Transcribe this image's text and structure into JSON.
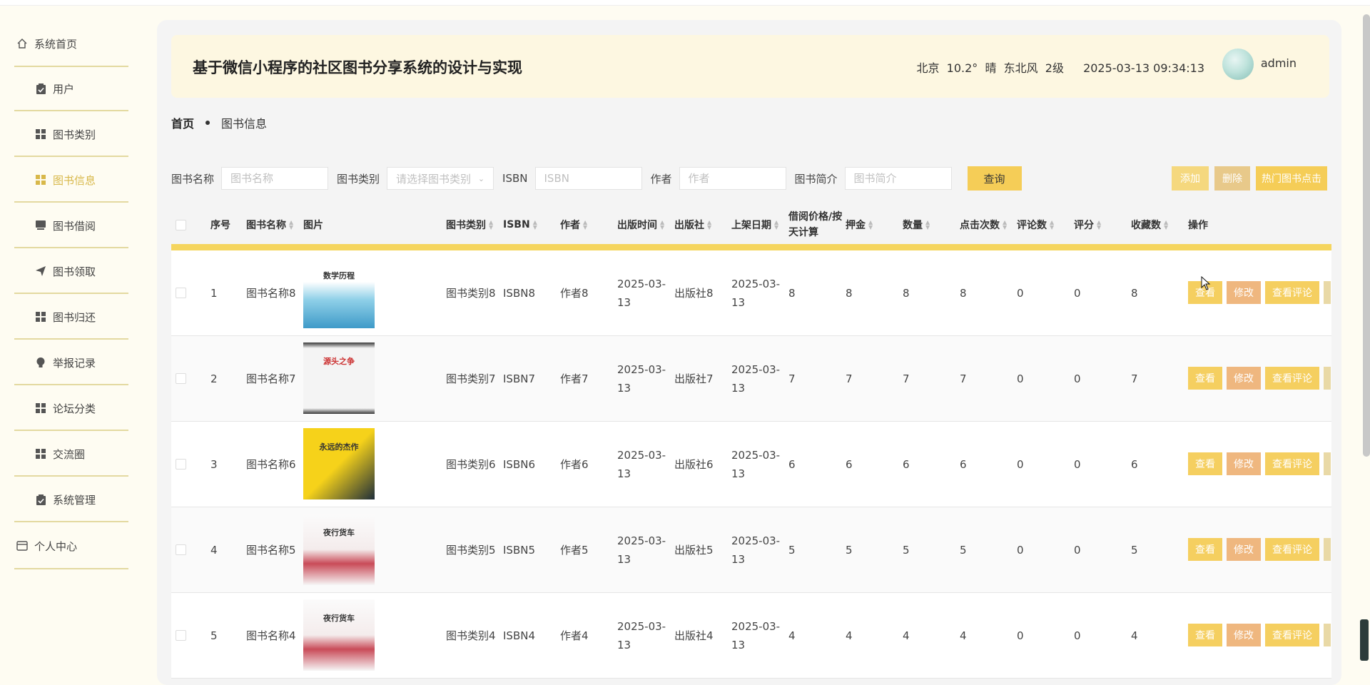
{
  "app_title": "基于微信小程序的社区图书分享系统的设计与实现",
  "header": {
    "weather": "北京  10.2°  晴  东北风  2级",
    "datetime": "2025-03-13 09:34:13",
    "username": "admin"
  },
  "sidebar": {
    "items": [
      {
        "label": "系统首页",
        "icon": "home-icon"
      },
      {
        "label": "用户",
        "icon": "clipboard-icon"
      },
      {
        "label": "图书类别",
        "icon": "grid-icon"
      },
      {
        "label": "图书信息",
        "icon": "grid-icon",
        "active": true
      },
      {
        "label": "图书借阅",
        "icon": "book-icon"
      },
      {
        "label": "图书领取",
        "icon": "send-icon"
      },
      {
        "label": "图书归还",
        "icon": "grid-icon"
      },
      {
        "label": "举报记录",
        "icon": "bulb-icon"
      },
      {
        "label": "论坛分类",
        "icon": "grid-icon"
      },
      {
        "label": "交流圈",
        "icon": "grid-icon"
      },
      {
        "label": "系统管理",
        "icon": "clipboard-icon"
      },
      {
        "label": "个人中心",
        "icon": "card-icon"
      }
    ]
  },
  "breadcrumb": {
    "home": "首页",
    "current": "图书信息"
  },
  "search": {
    "name_label": "图书名称",
    "name_placeholder": "图书名称",
    "type_label": "图书类别",
    "type_placeholder": "请选择图书类别",
    "isbn_label": "ISBN",
    "isbn_placeholder": "ISBN",
    "author_label": "作者",
    "author_placeholder": "作者",
    "intro_label": "图书简介",
    "intro_placeholder": "图书简介",
    "query_button": "查询"
  },
  "toolbar": {
    "add": "添加",
    "delete": "删除",
    "hot": "热门图书点击"
  },
  "table": {
    "headers": {
      "index": "序号",
      "name": "图书名称",
      "image": "图片",
      "type": "图书类别",
      "isbn": "ISBN",
      "author": "作者",
      "pubdate": "出版时间",
      "publisher": "出版社",
      "shelfdate": "上架日期",
      "price": "借阅价格/按天计算",
      "deposit": "押金",
      "quantity": "数量",
      "clicks": "点击次数",
      "comments": "评论数",
      "score": "评分",
      "favorites": "收藏数",
      "actions": "操作"
    },
    "row_actions": {
      "view": "查看",
      "edit": "修改",
      "comments": "查看评论"
    },
    "rows": [
      {
        "index": "1",
        "name": "图书名称8",
        "type": "图书类别8",
        "isbn": "ISBN8",
        "author": "作者8",
        "pubdate": "2025-03-13",
        "publisher": "出版社8",
        "shelfdate": "2025-03-13",
        "price": "8",
        "deposit": "8",
        "quantity": "8",
        "clicks": "8",
        "comments": "0",
        "score": "0",
        "favorites": "8",
        "cover_title": "数学历程"
      },
      {
        "index": "2",
        "name": "图书名称7",
        "type": "图书类别7",
        "isbn": "ISBN7",
        "author": "作者7",
        "pubdate": "2025-03-13",
        "publisher": "出版社7",
        "shelfdate": "2025-03-13",
        "price": "7",
        "deposit": "7",
        "quantity": "7",
        "clicks": "7",
        "comments": "0",
        "score": "0",
        "favorites": "7",
        "cover_title": "源头之争"
      },
      {
        "index": "3",
        "name": "图书名称6",
        "type": "图书类别6",
        "isbn": "ISBN6",
        "author": "作者6",
        "pubdate": "2025-03-13",
        "publisher": "出版社6",
        "shelfdate": "2025-03-13",
        "price": "6",
        "deposit": "6",
        "quantity": "6",
        "clicks": "6",
        "comments": "0",
        "score": "0",
        "favorites": "6",
        "cover_title": "永远的杰作"
      },
      {
        "index": "4",
        "name": "图书名称5",
        "type": "图书类别5",
        "isbn": "ISBN5",
        "author": "作者5",
        "pubdate": "2025-03-13",
        "publisher": "出版社5",
        "shelfdate": "2025-03-13",
        "price": "5",
        "deposit": "5",
        "quantity": "5",
        "clicks": "5",
        "comments": "0",
        "score": "0",
        "favorites": "5",
        "cover_title": "夜行货车"
      },
      {
        "index": "5",
        "name": "图书名称4",
        "type": "图书类别4",
        "isbn": "ISBN4",
        "author": "作者4",
        "pubdate": "2025-03-13",
        "publisher": "出版社4",
        "shelfdate": "2025-03-13",
        "price": "4",
        "deposit": "4",
        "quantity": "4",
        "clicks": "4",
        "comments": "0",
        "score": "0",
        "favorites": "4",
        "cover_title": "夜行货车"
      }
    ]
  }
}
